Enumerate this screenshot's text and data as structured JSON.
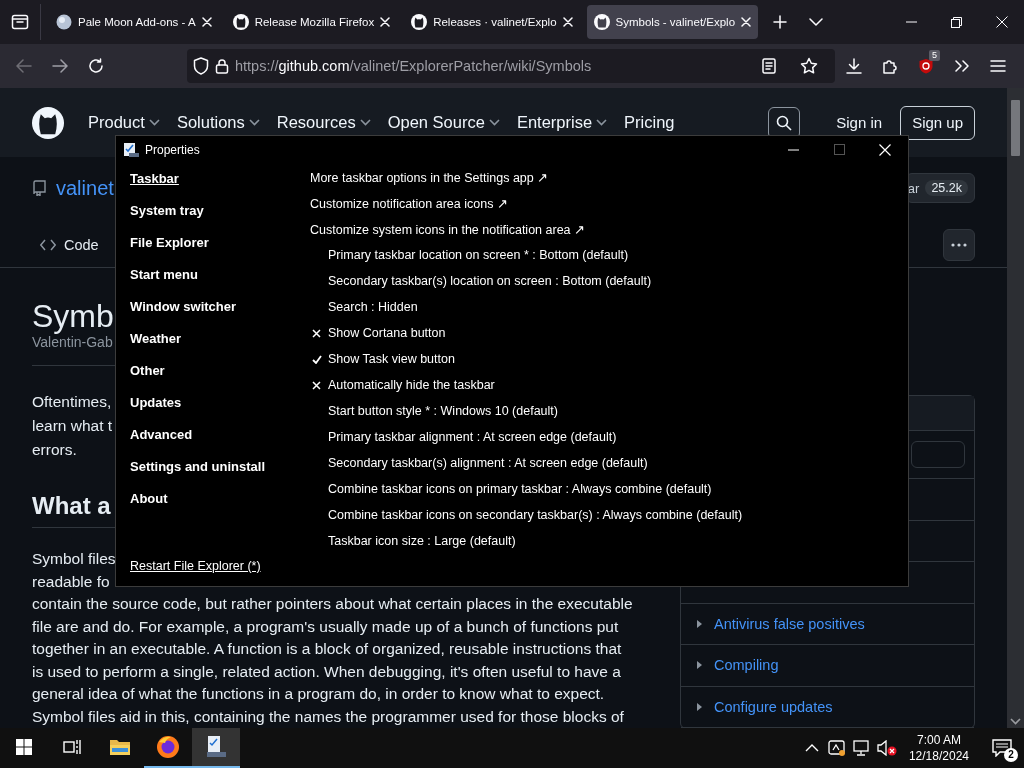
{
  "browser": {
    "tabs": [
      {
        "title": "Pale Moon Add-ons - A",
        "selected": false
      },
      {
        "title": "Release Mozilla Firefox",
        "selected": false
      },
      {
        "title": "Releases · valinet/Explo",
        "selected": false
      },
      {
        "title": "Symbols - valinet/Explo",
        "selected": true
      }
    ],
    "address": {
      "prefix": "https://",
      "domain": "github.com",
      "path": "/valinet/ExplorerPatcher/wiki/Symbols"
    },
    "extension_badge": "5"
  },
  "site_header": {
    "nav": [
      {
        "label": "Product",
        "dropdown": true
      },
      {
        "label": "Solutions",
        "dropdown": true
      },
      {
        "label": "Resources",
        "dropdown": true
      },
      {
        "label": "Open Source",
        "dropdown": true
      },
      {
        "label": "Enterprise",
        "dropdown": true
      },
      {
        "label": "Pricing",
        "dropdown": false
      }
    ],
    "sign_in": "Sign in",
    "sign_up": "Sign up"
  },
  "repo_header": {
    "owner": "valinet",
    "star_label": "ar",
    "star_count": "25.2k",
    "tabs": [
      {
        "label": "Code"
      }
    ]
  },
  "article": {
    "title": "Symb",
    "byline": "Valentin-Gab",
    "intro_lines": [
      "Oftentimes,",
      "learn what t",
      "errors."
    ],
    "heading": "What a",
    "body_lines": [
      "Symbol files",
      "readable fo",
      "contain the source code, but rather pointers about what certain places in the executable",
      "file are and do. For example, a program's usually made up of a bunch of functions put",
      "together in an executable. A function is a block of organized, reusable instructions that",
      "is used to perform a single, related action. When debugging, it's often useful to have a",
      "general idea of what the functions in a program do, in order to know what to expect.",
      "Symbol files aid in this, containing the names the programmer used for those blocks of"
    ]
  },
  "sidebar": {
    "pages": [
      {
        "title": "Antivirus false positives"
      },
      {
        "title": "Compiling"
      },
      {
        "title": "Configure updates"
      }
    ]
  },
  "dialog": {
    "title": "Properties",
    "sections": [
      {
        "label": "Taskbar",
        "selected": true
      },
      {
        "label": "System tray",
        "selected": false
      },
      {
        "label": "File Explorer",
        "selected": false
      },
      {
        "label": "Start menu",
        "selected": false
      },
      {
        "label": "Window switcher",
        "selected": false
      },
      {
        "label": "Weather",
        "selected": false
      },
      {
        "label": "Other",
        "selected": false
      },
      {
        "label": "Updates",
        "selected": false
      },
      {
        "label": "Advanced",
        "selected": false
      },
      {
        "label": "Settings and uninstall",
        "selected": false
      },
      {
        "label": "About",
        "selected": false
      }
    ],
    "restart_link": "Restart File Explorer (*)",
    "options": [
      {
        "kind": "link",
        "text": "More taskbar options in the Settings app ↗"
      },
      {
        "kind": "link",
        "text": "Customize notification area icons ↗"
      },
      {
        "kind": "link",
        "text": "Customize system icons in the notification area ↗"
      },
      {
        "kind": "setting",
        "text": "Primary taskbar location on screen * : Bottom (default)"
      },
      {
        "kind": "setting",
        "text": "Secondary taskbar(s) location on screen : Bottom (default)"
      },
      {
        "kind": "setting",
        "text": "Search : Hidden"
      },
      {
        "kind": "toggle",
        "text": "Show Cortana button",
        "checked": false
      },
      {
        "kind": "toggle",
        "text": "Show Task view button",
        "checked": true
      },
      {
        "kind": "toggle",
        "text": "Automatically hide the taskbar",
        "checked": false
      },
      {
        "kind": "setting",
        "text": "Start button style * : Windows 10 (default)"
      },
      {
        "kind": "setting",
        "text": "Primary taskbar alignment : At screen edge (default)"
      },
      {
        "kind": "setting",
        "text": "Secondary taskbar(s) alignment : At screen edge (default)"
      },
      {
        "kind": "setting",
        "text": "Combine taskbar icons on primary taskbar : Always combine (default)"
      },
      {
        "kind": "setting",
        "text": "Combine taskbar icons on secondary taskbar(s) : Always combine (default)"
      },
      {
        "kind": "setting",
        "text": "Taskbar icon size : Large (default)"
      }
    ]
  },
  "taskbar": {
    "apps": [
      {
        "kind": "start",
        "running": false,
        "focused": false
      },
      {
        "kind": "task_view",
        "running": false,
        "focused": false
      },
      {
        "kind": "folder",
        "running": false,
        "focused": false
      },
      {
        "kind": "browser",
        "running": true,
        "focused": false
      },
      {
        "kind": "window",
        "running": true,
        "focused": true
      }
    ],
    "time": "7:00 AM",
    "date": "12/18/2024",
    "notification_count": "2"
  }
}
